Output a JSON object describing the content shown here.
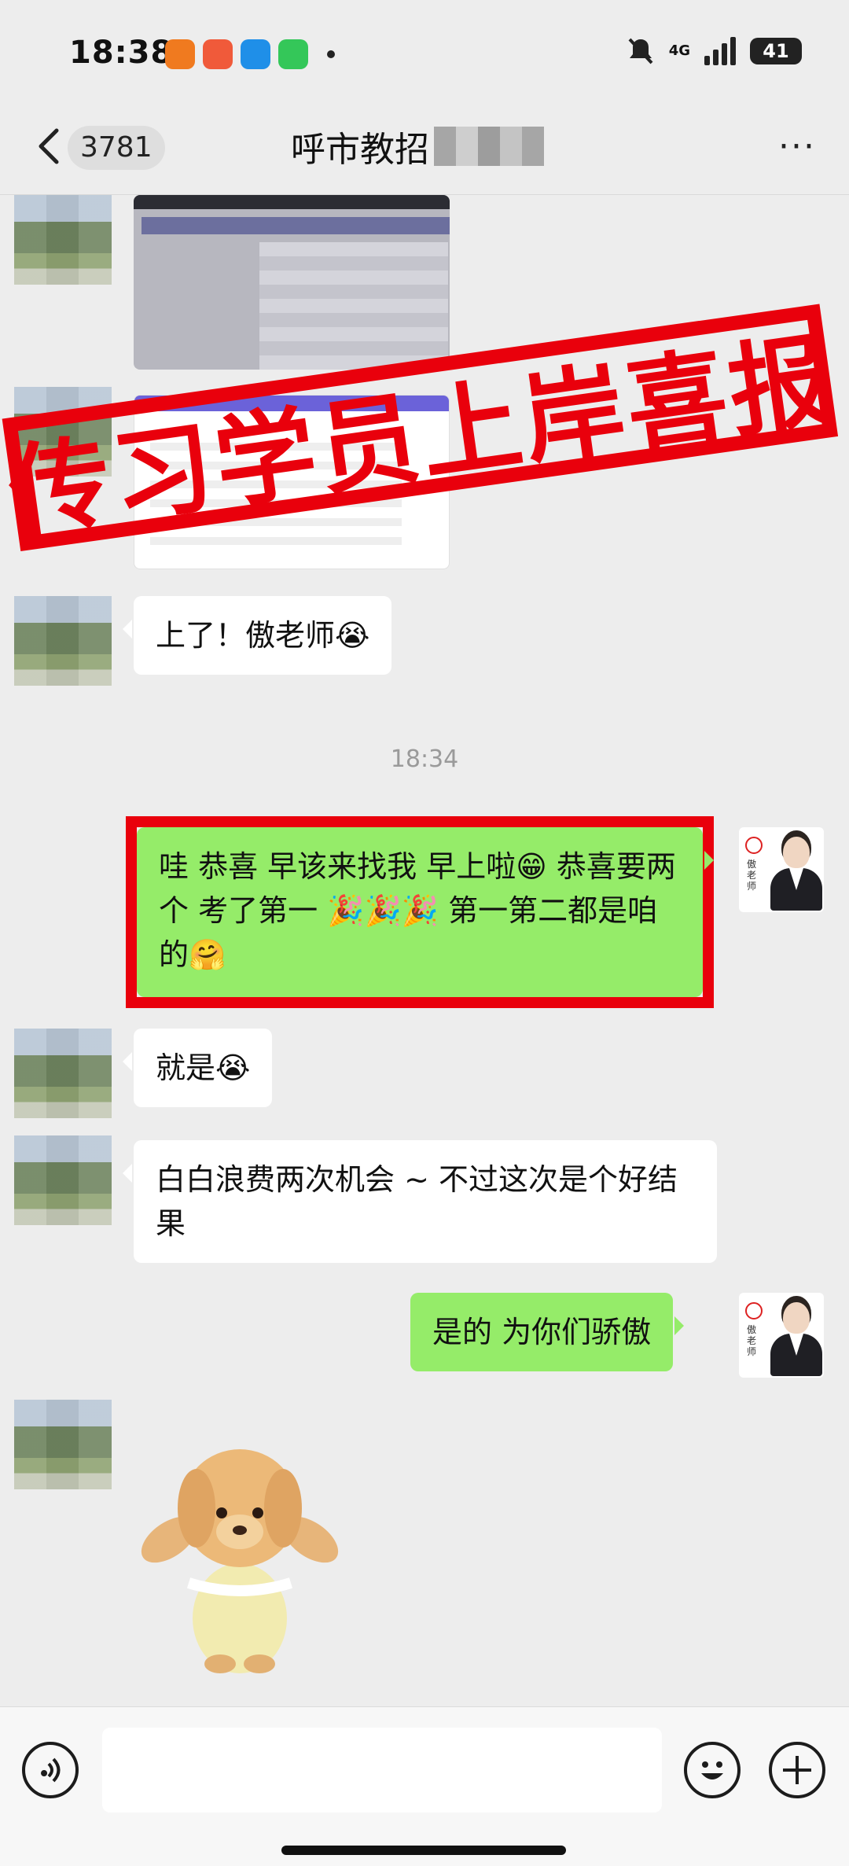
{
  "status_bar": {
    "time": "18:38",
    "network": "4G",
    "battery": "41"
  },
  "header": {
    "back_count": "3781",
    "title": "呼市教招",
    "more": "···"
  },
  "stamp": {
    "text": "传习学员上岸喜报",
    "color": "#e9000c"
  },
  "messages": {
    "m1": "上了！傲老师😭",
    "timestamp": "18:34",
    "m2": "哇 恭喜 早该来找我 早上啦😁 恭喜要两个 考了第一 🎉🎉🎉 第一第二都是咱的🤗",
    "m3": "就是😭",
    "m4": "白白浪费两次机会 ~ 不过这次是个好结果",
    "m5": "是的 为你们骄傲"
  },
  "teacher_avatar": {
    "seal_text": "傲老师"
  },
  "colors": {
    "bubble_green": "#95ec69",
    "bubble_white": "#ffffff",
    "chat_bg": "#ededed"
  },
  "input": {
    "placeholder": ""
  }
}
